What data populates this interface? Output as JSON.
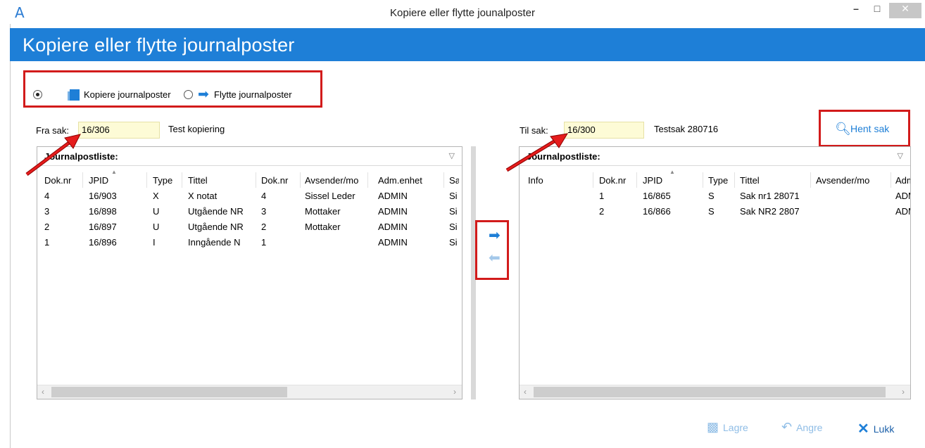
{
  "window": {
    "title": "Kopiere eller flytte jounalposter",
    "logo": "A",
    "minimize": "–",
    "maximize": "□",
    "close": "✕"
  },
  "header": {
    "title": "Kopiere eller flytte journalposter"
  },
  "mode": {
    "copy_label": "Kopiere journalposter",
    "move_label": "Flytte journalposter",
    "selected": "copy"
  },
  "from_case": {
    "label": "Fra sak:",
    "value": "16/306",
    "name": "Test kopiering"
  },
  "to_case": {
    "label": "Til sak:",
    "value": "16/300",
    "name": "Testsak 280716"
  },
  "hent_sak": {
    "label": "Hent sak",
    "icon": "search-icon"
  },
  "left_panel": {
    "title": "Journalpostliste:",
    "columns": [
      "Dok.nr",
      "JPID",
      "Type",
      "Tittel",
      "Dok.nr",
      "Avsender/mo",
      "Adm.enhet",
      "Sa"
    ],
    "rows": [
      [
        "4",
        "16/903",
        "X",
        "X notat",
        "4",
        "Sissel Leder",
        "ADMIN",
        "Si"
      ],
      [
        "3",
        "16/898",
        "U",
        "Utgående NR",
        "3",
        "Mottaker",
        "ADMIN",
        "Si"
      ],
      [
        "2",
        "16/897",
        "U",
        "Utgående NR",
        "2",
        "Mottaker",
        "ADMIN",
        "Si"
      ],
      [
        "1",
        "16/896",
        "I",
        "Inngående N",
        "1",
        "",
        "ADMIN",
        "Si"
      ]
    ]
  },
  "right_panel": {
    "title": "Journalpostliste:",
    "columns": [
      "Info",
      "Dok.nr",
      "JPID",
      "Type",
      "Tittel",
      "Avsender/mo",
      "Adm"
    ],
    "rows": [
      [
        "",
        "1",
        "16/865",
        "S",
        "Sak nr1 28071",
        "",
        "ADM"
      ],
      [
        "",
        "2",
        "16/866",
        "S",
        "Sak NR2 2807",
        "",
        "ADM"
      ]
    ]
  },
  "transfer": {
    "right_icon": "arrow-right-icon",
    "left_icon": "arrow-left-icon"
  },
  "footer": {
    "save_label": "Lagre",
    "undo_label": "Angre",
    "close_label": "Lukk"
  },
  "colors": {
    "accent": "#1e7fd7",
    "highlight_border": "#d21b1b",
    "input_bg": "#fdfbd6"
  }
}
